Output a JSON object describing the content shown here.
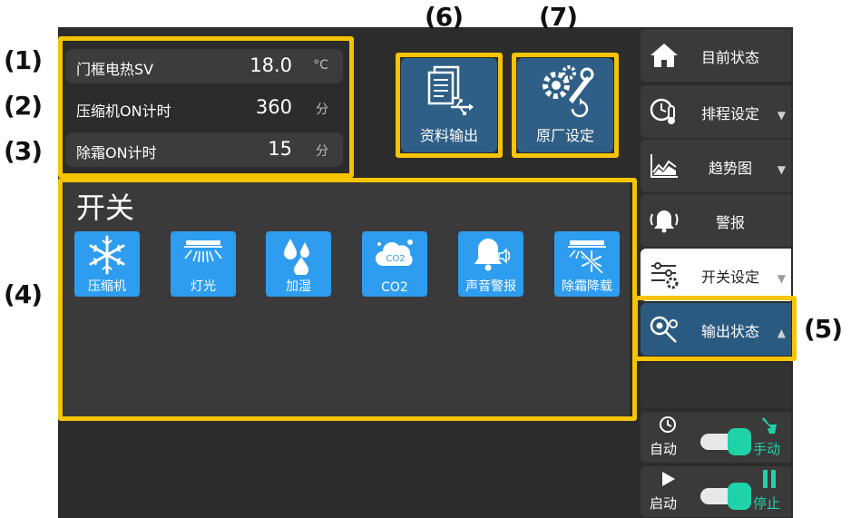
{
  "annotations": [
    "(1)",
    "(2)",
    "(3)",
    "(4)",
    "(5)",
    "(6)",
    "(7)"
  ],
  "params": [
    {
      "label": "门框电热SV",
      "value": "18.0",
      "unit": "°C"
    },
    {
      "label": "压缩机ON计时",
      "value": "360",
      "unit": "分"
    },
    {
      "label": "除霜ON计时",
      "value": "15",
      "unit": "分"
    }
  ],
  "buttons": {
    "data_output": {
      "label": "资料输出",
      "icon": "document-usb-icon"
    },
    "factory_settings": {
      "label": "原厂设定",
      "icon": "gear-wrench-icon"
    }
  },
  "switch_panel": {
    "title": "开关",
    "items": [
      {
        "label": "压缩机",
        "icon": "snowflake-icon"
      },
      {
        "label": "灯光",
        "icon": "light-bar-icon"
      },
      {
        "label": "加湿",
        "icon": "droplets-icon"
      },
      {
        "label": "CO2",
        "icon": "co2-cloud-icon"
      },
      {
        "label": "声音警报",
        "icon": "bell-sound-icon"
      },
      {
        "label": "除霜降载",
        "icon": "defrost-icon"
      }
    ]
  },
  "menu": [
    {
      "label": "目前状态",
      "icon": "home-icon",
      "arrow": ""
    },
    {
      "label": "排程设定",
      "icon": "schedule-thermometer-icon",
      "arrow": "▼"
    },
    {
      "label": "趋势图",
      "icon": "trend-chart-icon",
      "arrow": "▼"
    },
    {
      "label": "警报",
      "icon": "alarm-bell-icon",
      "arrow": ""
    },
    {
      "label": "开关设定",
      "icon": "sliders-gear-icon",
      "arrow": "▼"
    },
    {
      "label": "输出状态",
      "icon": "output-status-icon",
      "arrow": "▲"
    }
  ],
  "mode_toggles": [
    {
      "left_label": "自动",
      "left_icon": "clock-icon",
      "right_label": "手动",
      "right_icon": "hand-pointer-icon"
    },
    {
      "left_label": "启动",
      "left_icon": "play-icon",
      "right_label": "停止",
      "right_icon": "pause-icon"
    }
  ],
  "colors": {
    "highlight": "#f6c400",
    "screen_bg": "#2c2c2c",
    "tile_blue": "#2e9df0",
    "button_blue": "#2f5f86",
    "toggle_green": "#1fd3a8"
  }
}
